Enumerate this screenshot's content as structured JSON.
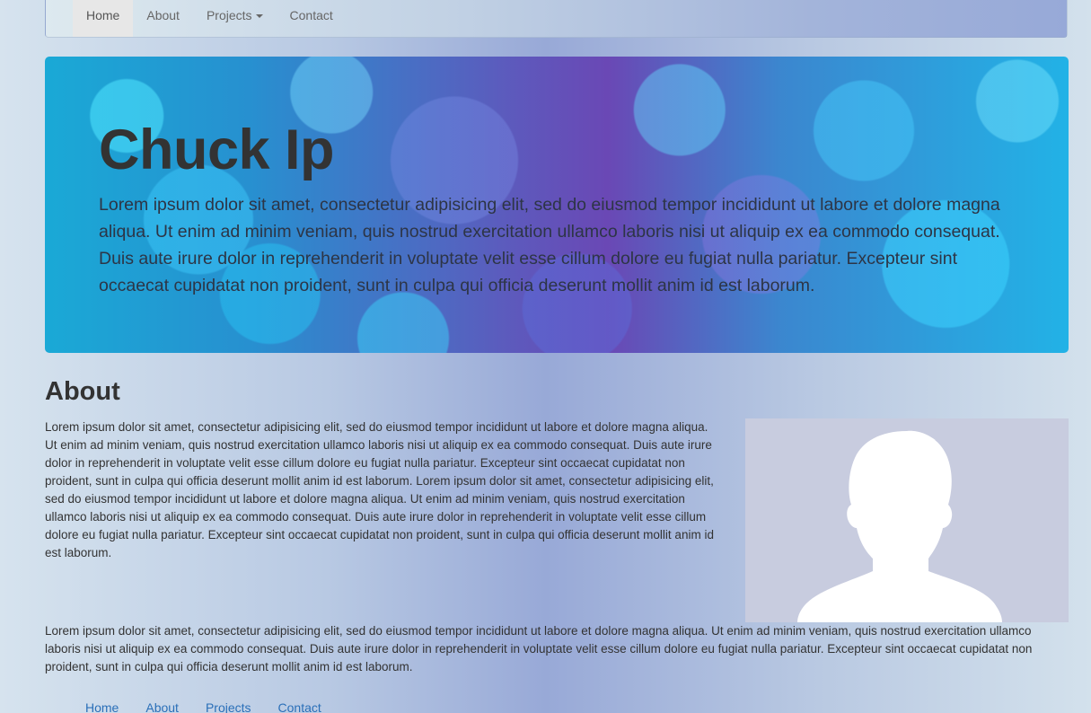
{
  "navbar": {
    "items": [
      {
        "label": "Home",
        "active": true
      },
      {
        "label": "About"
      },
      {
        "label": "Projects",
        "dropdown": true
      },
      {
        "label": "Contact"
      }
    ]
  },
  "jumbotron": {
    "title": "Chuck Ip",
    "text": "Lorem ipsum dolor sit amet, consectetur adipisicing elit, sed do eiusmod tempor incididunt ut labore et dolore magna aliqua. Ut enim ad minim veniam, quis nostrud exercitation ullamco laboris nisi ut aliquip ex ea commodo consequat. Duis aute irure dolor in reprehenderit in voluptate velit esse cillum dolore eu fugiat nulla pariatur. Excepteur sint occaecat cupidatat non proident, sunt in culpa qui officia deserunt mollit anim id est laborum."
  },
  "about": {
    "heading": "About",
    "paragraph1": "Lorem ipsum dolor sit amet, consectetur adipisicing elit, sed do eiusmod tempor incididunt ut labore et dolore magna aliqua. Ut enim ad minim veniam, quis nostrud exercitation ullamco laboris nisi ut aliquip ex ea commodo consequat. Duis aute irure dolor in reprehenderit in voluptate velit esse cillum dolore eu fugiat nulla pariatur. Excepteur sint occaecat cupidatat non proident, sunt in culpa qui officia deserunt mollit anim id est laborum. Lorem ipsum dolor sit amet, consectetur adipisicing elit, sed do eiusmod tempor incididunt ut labore et dolore magna aliqua. Ut enim ad minim veniam, quis nostrud exercitation ullamco laboris nisi ut aliquip ex ea commodo consequat. Duis aute irure dolor in reprehenderit in voluptate velit esse cillum dolore eu fugiat nulla pariatur. Excepteur sint occaecat cupidatat non proident, sunt in culpa qui officia deserunt mollit anim id est laborum.",
    "paragraph2": "Lorem ipsum dolor sit amet, consectetur adipisicing elit, sed do eiusmod tempor incididunt ut labore et dolore magna aliqua. Ut enim ad minim veniam, quis nostrud exercitation ullamco laboris nisi ut aliquip ex ea commodo consequat. Duis aute irure dolor in reprehenderit in voluptate velit esse cillum dolore eu fugiat nulla pariatur. Excepteur sint occaecat cupidatat non proident, sunt in culpa qui officia deserunt mollit anim id est laborum.",
    "image_icon": "default-profile-silhouette-icon"
  },
  "footer": {
    "links": [
      "Home",
      "About",
      "Projects",
      "Contact"
    ]
  },
  "colors": {
    "link": "#2a6fb8",
    "nav_active_bg": "#e7e7e7",
    "profile_bg": "#c8ccdf"
  }
}
